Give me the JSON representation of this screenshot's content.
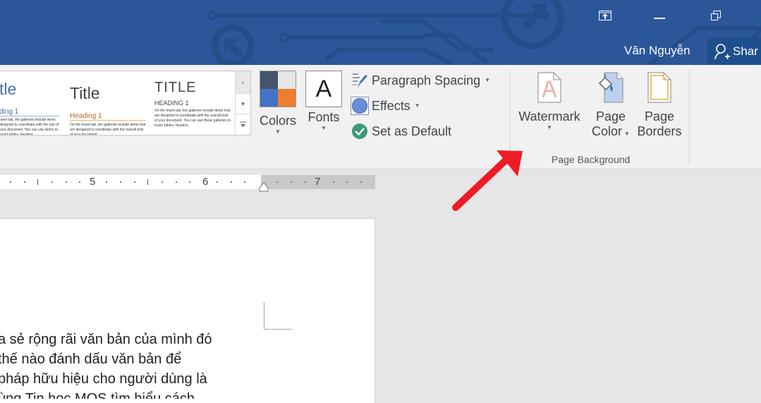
{
  "titlebar": {
    "user_name": "Văn Nguyễn",
    "share_label": "Shar",
    "brand_color": "#2b579a",
    "icons": [
      "ribbon-display-options-icon",
      "minimize-icon",
      "restore-icon"
    ]
  },
  "ribbon": {
    "style_gallery": {
      "items": [
        {
          "title": "tle",
          "heading": "ding 1",
          "body": "nsert tab, the galleries include items designed to coordinate with the ook of your document. You can use lleries to insert tables, headers,"
        },
        {
          "title": "Title",
          "heading": "Heading 1",
          "body": "On the Insert tab, the galleries include items that are designed to coordinate with the overall look of your document."
        },
        {
          "title": "TITLE",
          "heading": "HEADING 1",
          "body": "On the Insert tab, the galleries include items that are designed to coordinate with the overall look of your document. You can use these galleries to insert tables, headers,"
        }
      ]
    },
    "colors_label": "Colors",
    "fonts_label": "Fonts",
    "fonts_glyph": "A",
    "paragraph_spacing_label": "Paragraph Spacing",
    "effects_label": "Effects",
    "set_default_label": "Set as Default",
    "page_background": {
      "group_label": "Page Background",
      "watermark_label": "Watermark",
      "page_color_line1": "Page",
      "page_color_line2": "Color",
      "page_borders_line1": "Page",
      "page_borders_line2": "Borders"
    },
    "theme_swatch_colors": [
      "#44546a",
      "#e7e6e6",
      "#4472c4",
      "#ed7d31"
    ]
  },
  "ruler": {
    "numbers": [
      "5",
      "6",
      "7"
    ]
  },
  "document": {
    "lines": [
      "a sẻ rộng rãi văn bản của mình đó",
      " thế nào đánh dấu văn bản để",
      " pháp hữu hiệu cho người dùng là",
      "ùng Tin học MOS tìm hiểu cách"
    ]
  },
  "annotation": {
    "arrow_color": "#ee1c25",
    "points_to": "Watermark"
  }
}
